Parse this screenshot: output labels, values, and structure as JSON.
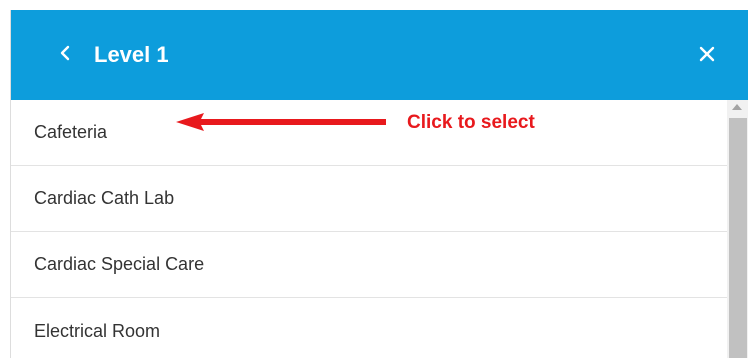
{
  "header": {
    "title": "Level 1",
    "back_icon": "chevron-left-icon",
    "close_icon": "close-icon",
    "background_color": "#0d9ddc"
  },
  "list": {
    "items": [
      {
        "label": "Cafeteria"
      },
      {
        "label": "Cardiac Cath Lab"
      },
      {
        "label": "Cardiac Special Care"
      },
      {
        "label": "Electrical Room"
      }
    ]
  },
  "annotation": {
    "text": "Click to select",
    "color": "#e8191d"
  }
}
